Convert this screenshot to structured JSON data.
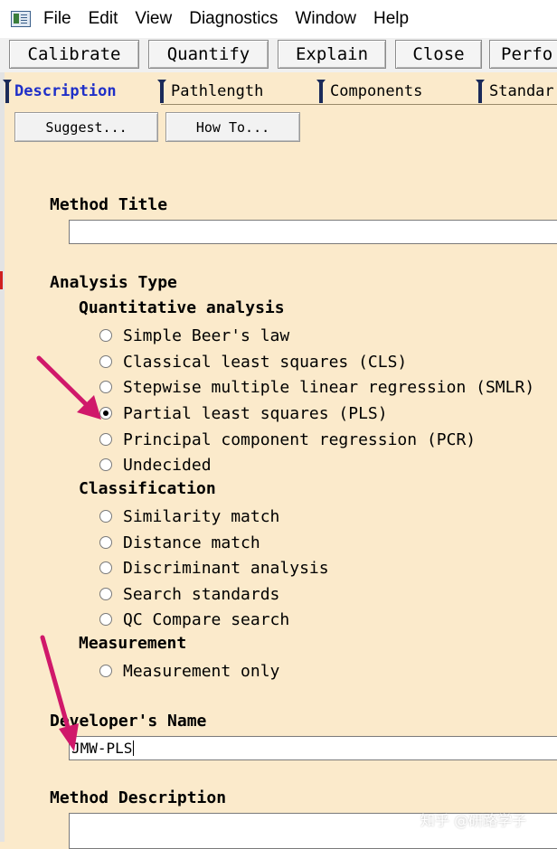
{
  "menu": [
    "File",
    "Edit",
    "View",
    "Diagnostics",
    "Window",
    "Help"
  ],
  "toolbar": {
    "calibrate": "Calibrate",
    "quantify": "Quantify",
    "explain": "Explain",
    "close": "Close",
    "perform": "Perfo"
  },
  "tabs": {
    "description": "Description",
    "pathlength": "Pathlength",
    "components": "Components",
    "standards": "Standar"
  },
  "buttons": {
    "suggest": "Suggest...",
    "how_to": "How To..."
  },
  "method_title": {
    "label": "Method Title",
    "value": ""
  },
  "analysis": {
    "title": "Analysis Type",
    "quantitative": {
      "title": "Quantitative analysis",
      "options": [
        "Simple Beer's law",
        "Classical least squares (CLS)",
        "Stepwise multiple linear regression (SMLR)",
        "Partial least squares (PLS)",
        "Principal component regression (PCR)",
        "Undecided"
      ],
      "selected": "Partial least squares (PLS)"
    },
    "classification": {
      "title": "Classification",
      "options": [
        "Similarity match",
        "Distance match",
        "Discriminant analysis",
        "Search standards",
        "QC Compare search"
      ]
    },
    "measurement": {
      "title": "Measurement",
      "options": [
        "Measurement only"
      ]
    }
  },
  "developer": {
    "label": "Developer's Name",
    "value": "JMW-PLS"
  },
  "method_description": {
    "label": "Method Description"
  },
  "watermark": "知乎 @研路学子",
  "colors": {
    "background": "#fbeacb",
    "active_tab": "#1f2fc8",
    "arrow": "#d0186a"
  }
}
